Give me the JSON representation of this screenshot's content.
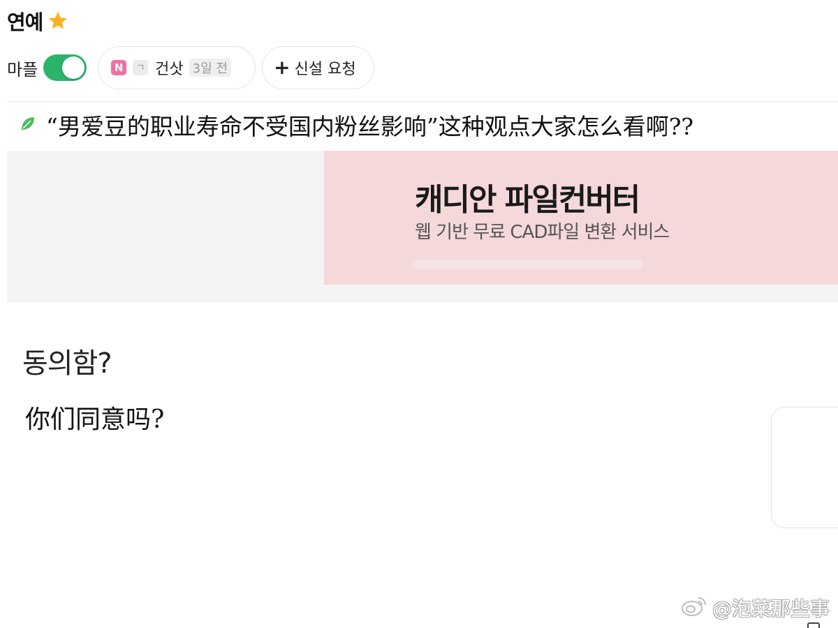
{
  "board": {
    "title": "연예",
    "favorite_icon": "star-icon"
  },
  "toolbar": {
    "toggle_label": "마플",
    "toggle_on": true,
    "user_chip": {
      "badge": "N",
      "grade": "ㄱ",
      "name": "건삿",
      "time": "3일 전"
    },
    "request_button": {
      "plus": "+",
      "label": "신설 요청"
    }
  },
  "post": {
    "title_icon": "leaf-icon",
    "title": "“男爱豆的职业寿命不受国内粉丝影响”这种观点大家怎么看啊??",
    "body_ko": "동의함?",
    "body_zh": "你们同意吗?"
  },
  "ad": {
    "title": "캐디안 파일컨버터",
    "subtitle": "웹 기반 무료 CAD파일 변환 서비스"
  },
  "watermark": {
    "text": "@泡菜那些事",
    "icon": "weibo-icon"
  },
  "colors": {
    "toggle": "#2bb36a",
    "badge": "#f06fa4",
    "star": "#f5b323",
    "leaf": "#4cbb5c",
    "ad_pink": "#f5d8da"
  }
}
